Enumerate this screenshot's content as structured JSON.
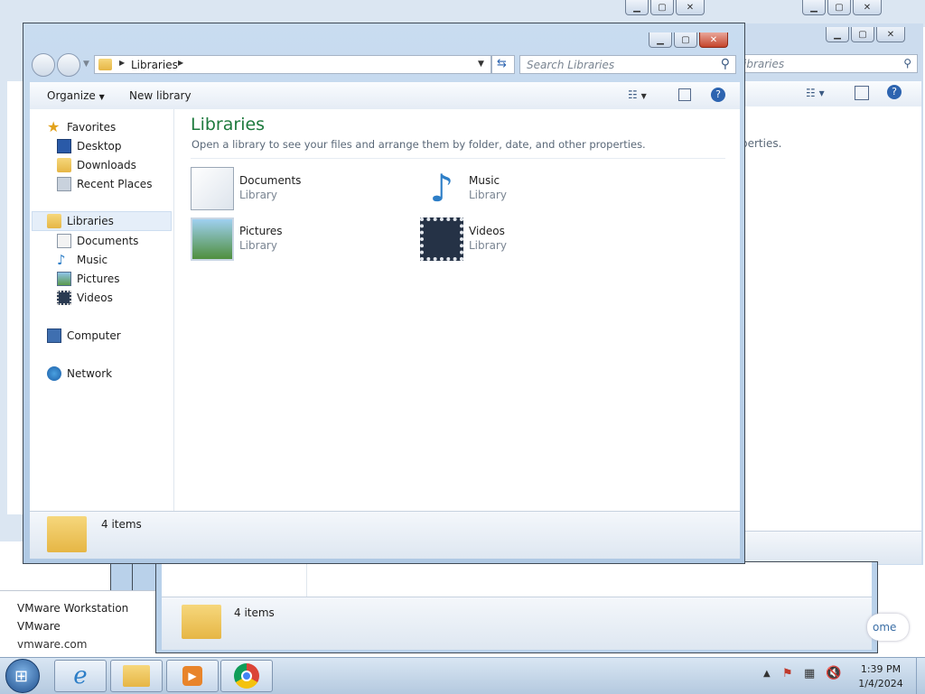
{
  "back_windows": {
    "win1_search_partial": "ibraries",
    "win1_status": "4 items"
  },
  "jumplist": {
    "line1": "VMware Workstation",
    "line2": "VMware",
    "line3": "vmware.com",
    "right_partial": "ome"
  },
  "explorer": {
    "address_path": "Libraries",
    "search_placeholder": "Search Libraries",
    "toolbar": {
      "organize": "Organize",
      "new_library": "New library"
    },
    "nav": {
      "favorites": "Favorites",
      "desktop": "Desktop",
      "downloads": "Downloads",
      "recent_places": "Recent Places",
      "libraries": "Libraries",
      "documents": "Documents",
      "music": "Music",
      "pictures": "Pictures",
      "videos": "Videos",
      "computer": "Computer",
      "network": "Network"
    },
    "content": {
      "title": "Libraries",
      "description": "Open a library to see your files and arrange them by folder, date, and other properties.",
      "partial_back_description": "perties.",
      "libraries": [
        {
          "name": "Documents",
          "type": "Library"
        },
        {
          "name": "Music",
          "type": "Library"
        },
        {
          "name": "Pictures",
          "type": "Library"
        },
        {
          "name": "Videos",
          "type": "Library"
        }
      ]
    },
    "status": "4 items"
  },
  "lower_window_status": "4 items",
  "taskbar": {
    "time": "1:39 PM",
    "date": "1/4/2024"
  },
  "colors": {
    "title_green": "#1e7a3e",
    "accent": "#3b6ea5"
  }
}
